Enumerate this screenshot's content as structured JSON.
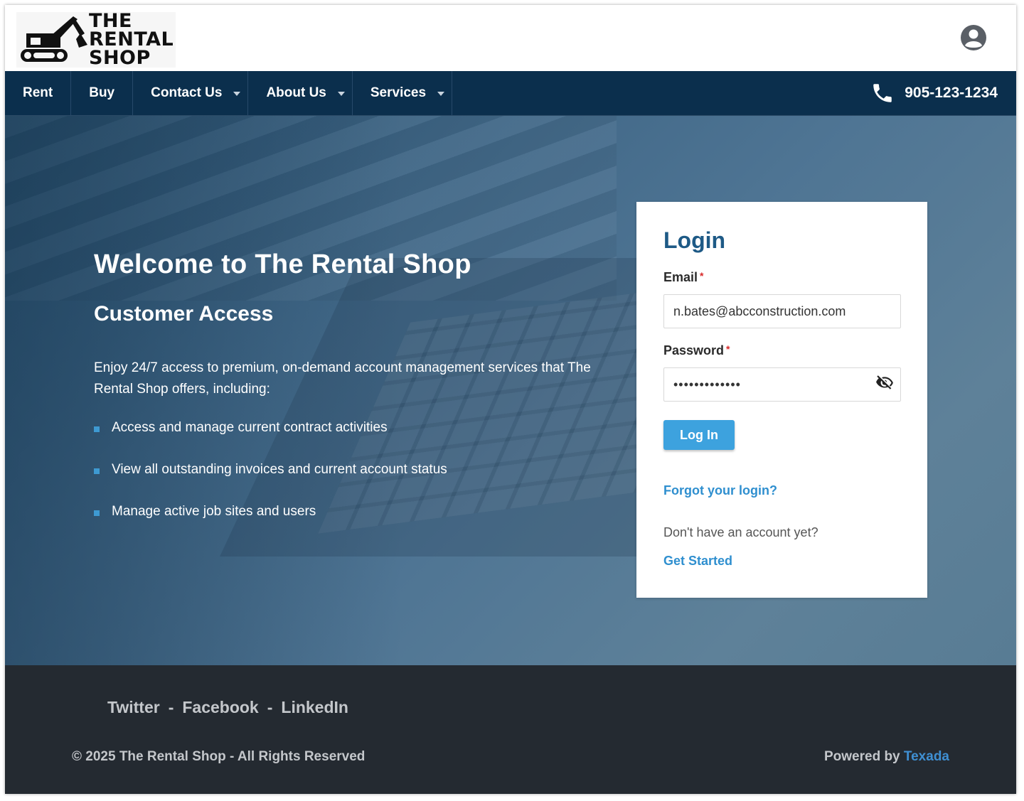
{
  "header": {
    "logo": {
      "line1": "THE",
      "line2": "RENTAL",
      "line3": "SHOP"
    }
  },
  "nav": {
    "items": [
      {
        "label": "Rent",
        "has_dropdown": false
      },
      {
        "label": "Buy",
        "has_dropdown": false
      },
      {
        "label": "Contact Us",
        "has_dropdown": true
      },
      {
        "label": "About Us",
        "has_dropdown": true
      },
      {
        "label": "Services",
        "has_dropdown": true
      }
    ],
    "phone": "905-123-1234"
  },
  "hero": {
    "title": "Welcome to The Rental Shop",
    "subtitle": "Customer Access",
    "description": "Enjoy 24/7 access to premium, on-demand account management services that The Rental Shop offers, including:",
    "bullets": [
      "Access and manage current contract activities",
      "View all outstanding invoices and current account status",
      "Manage active job sites and users"
    ]
  },
  "login": {
    "title": "Login",
    "email_label": "Email",
    "email_value": "n.bates@abcconstruction.com",
    "password_label": "Password",
    "password_value": "•••••••••••••",
    "required_mark": "*",
    "button_label": "Log In",
    "forgot_link": "Forgot your login?",
    "no_account_text": "Don't have an account yet?",
    "get_started_link": "Get Started"
  },
  "footer": {
    "social": [
      "Twitter",
      "Facebook",
      "LinkedIn"
    ],
    "separator": "-",
    "copyright": "© 2025 The Rental Shop - All Rights Reserved",
    "powered_by": "Powered by",
    "powered_brand": "Texada"
  },
  "colors": {
    "nav_bg": "#0b2f4d",
    "accent": "#3da2de",
    "title_blue": "#1e5a86",
    "footer_bg": "#242a31"
  },
  "icons": [
    "excavator-logo-icon",
    "account-circle-icon",
    "phone-icon",
    "eye-off-icon",
    "bullet-square-icon"
  ]
}
